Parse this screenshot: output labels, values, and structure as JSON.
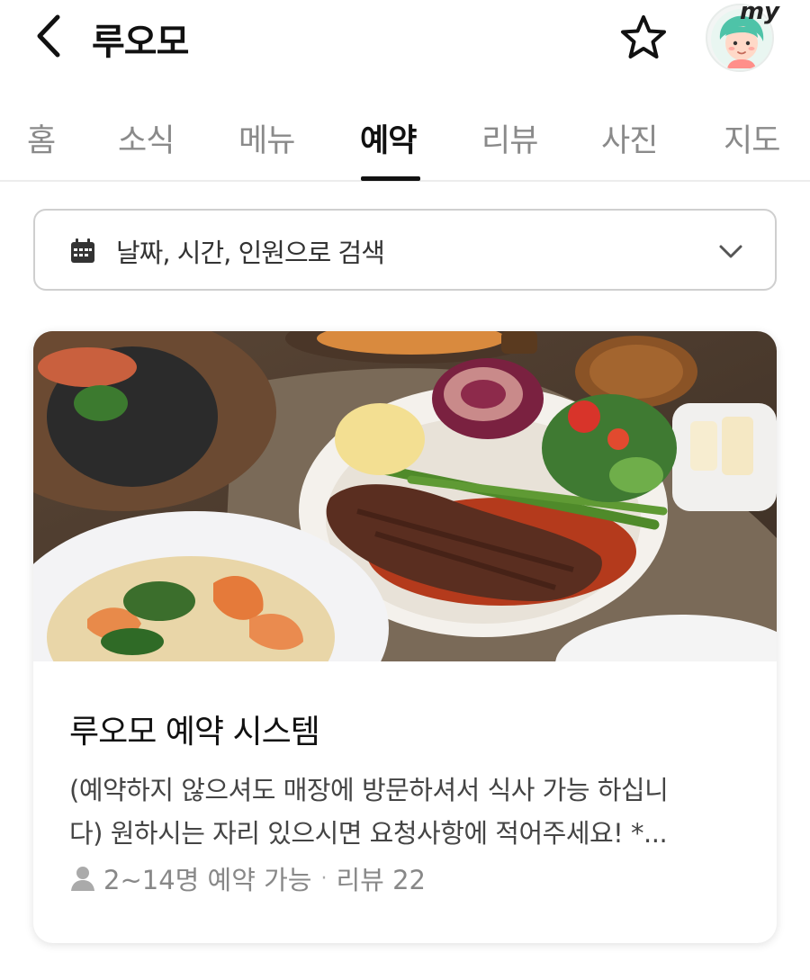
{
  "header": {
    "title": "루오모",
    "avatar_badge": "my"
  },
  "tabs": [
    {
      "label": "홈",
      "active": false
    },
    {
      "label": "소식",
      "active": false
    },
    {
      "label": "메뉴",
      "active": false
    },
    {
      "label": "예약",
      "active": true
    },
    {
      "label": "리뷰",
      "active": false
    },
    {
      "label": "사진",
      "active": false
    },
    {
      "label": "지도",
      "active": false
    }
  ],
  "search": {
    "label": "날짜, 시간, 인원으로 검색"
  },
  "card": {
    "title": "루오모 예약 시스템",
    "description_line1": "(예약하지 않으셔도 매장에 방문하셔서 식사 가능 하십니",
    "description_line2": "다) 원하시는 자리 있으시면 요청사항에 적어주세요! *...",
    "capacity": "2~14명 예약 가능",
    "separator": "·",
    "reviews": "리뷰 22"
  },
  "icons": {
    "back": "chevron-left-icon",
    "favorite": "star-outline-icon",
    "calendar": "calendar-icon",
    "dropdown": "chevron-down-icon",
    "person": "person-icon"
  }
}
